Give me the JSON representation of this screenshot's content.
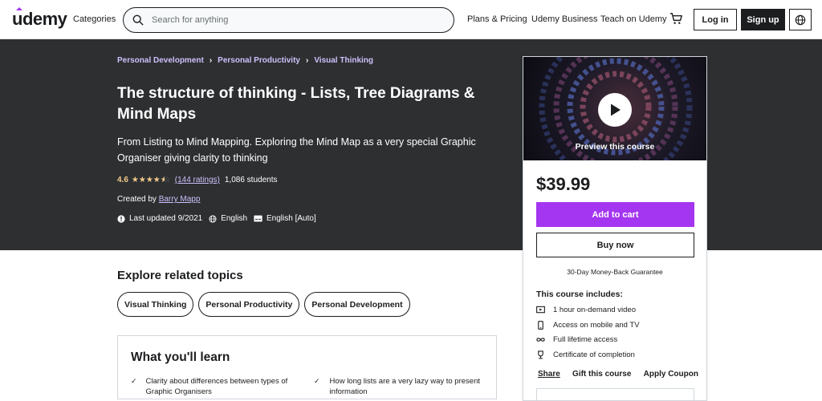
{
  "header": {
    "logo": "udemy",
    "categories": "Categories",
    "search_placeholder": "Search for anything",
    "links": [
      "Plans & Pricing",
      "Udemy Business",
      "Teach on Udemy"
    ],
    "login": "Log in",
    "signup": "Sign up",
    "icons": {
      "search": "search-icon",
      "cart": "cart-icon",
      "language": "globe-icon"
    }
  },
  "course": {
    "breadcrumbs": [
      "Personal Development",
      "Personal Productivity",
      "Visual Thinking"
    ],
    "title": "The structure of thinking - Lists, Tree Diagrams & Mind Maps",
    "subtitle": "From Listing to Mind Mapping. Exploring the Mind Map as a very special Graphic Organiser giving clarity to thinking",
    "rating": "4.6",
    "stars": 4.6,
    "ratings_count": "(144 ratings)",
    "students": "1,086 students",
    "created_by_label": "Created by",
    "instructor": "Barry Mapp",
    "last_updated": "Last updated 9/2021",
    "language": "English",
    "captions": "English [Auto]"
  },
  "sidebar": {
    "preview_label": "Preview this course",
    "price": "$39.99",
    "add_to_cart": "Add to cart",
    "buy_now": "Buy now",
    "guarantee": "30-Day Money-Back Guarantee",
    "includes_title": "This course includes:",
    "includes": [
      {
        "icon": "video-icon",
        "text": "1 hour on-demand video"
      },
      {
        "icon": "mobile-icon",
        "text": "Access on mobile and TV"
      },
      {
        "icon": "infinity-icon",
        "text": "Full lifetime access"
      },
      {
        "icon": "trophy-icon",
        "text": "Certificate of completion"
      }
    ],
    "share": "Share",
    "gift": "Gift this course",
    "coupon": "Apply Coupon"
  },
  "explore": {
    "title": "Explore related topics",
    "topics": [
      "Visual Thinking",
      "Personal Productivity",
      "Personal Development"
    ]
  },
  "learn": {
    "title": "What you'll learn",
    "items": [
      "Clarity about differences between types of Graphic Organisers",
      "How long lists are a very lazy way to present information"
    ]
  },
  "colors": {
    "accent": "#a435f0",
    "banner": "#2d2f31",
    "link_light": "#cec0fc",
    "star": "#f3ca8c"
  }
}
